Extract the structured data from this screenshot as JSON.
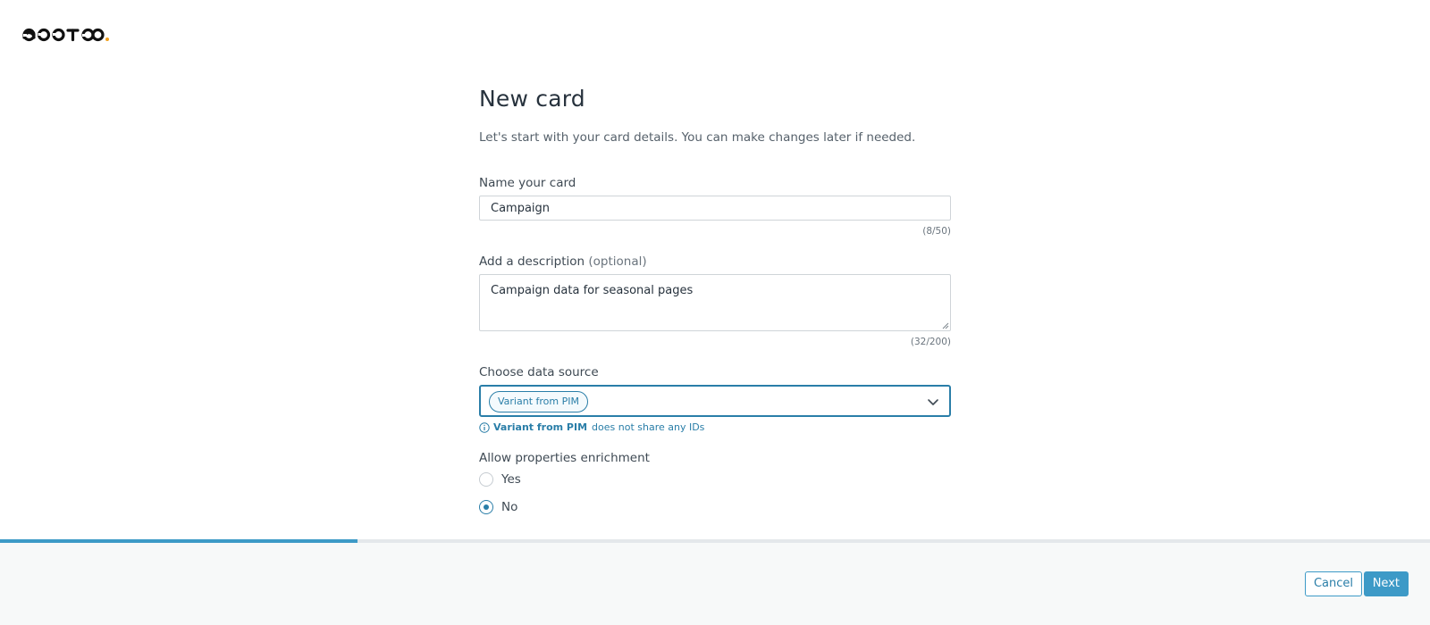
{
  "logo": {
    "text": "OCCTOO",
    "dot_color": "#f0a020"
  },
  "page": {
    "title": "New card",
    "subtitle": "Let's start with your card details. You can make changes later if needed."
  },
  "name_field": {
    "label": "Name your card",
    "value": "Campaign",
    "counter": "(8/50)"
  },
  "description_field": {
    "label": "Add a description",
    "optional": "(optional)",
    "value": "Campaign data for seasonal pages",
    "counter": "(32/200)"
  },
  "data_source": {
    "label": "Choose data source",
    "selected": "Variant from PIM",
    "info_source": "Variant from PIM",
    "info_text": "does not share any IDs"
  },
  "enrichment": {
    "label": "Allow properties enrichment",
    "options": [
      {
        "label": "Yes",
        "checked": false
      },
      {
        "label": "No",
        "checked": true
      }
    ]
  },
  "progress": {
    "fraction": 0.25
  },
  "footer": {
    "cancel_label": "Cancel",
    "next_label": "Next"
  },
  "colors": {
    "accent": "#2a7ea8",
    "primary_button": "#3d9ac7",
    "footer_bg": "#f7f9f9"
  },
  "icons": {
    "select": "chevron-down-icon",
    "info": "info-icon"
  }
}
